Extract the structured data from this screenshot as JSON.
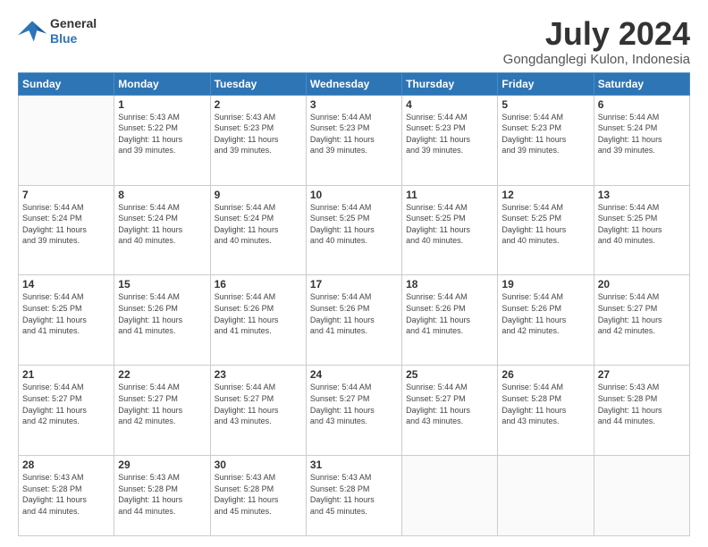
{
  "header": {
    "logo_line1": "General",
    "logo_line2": "Blue",
    "title": "July 2024",
    "subtitle": "Gongdanglegi Kulon, Indonesia"
  },
  "calendar": {
    "days_of_week": [
      "Sunday",
      "Monday",
      "Tuesday",
      "Wednesday",
      "Thursday",
      "Friday",
      "Saturday"
    ],
    "weeks": [
      [
        {
          "day": "",
          "info": ""
        },
        {
          "day": "1",
          "info": "Sunrise: 5:43 AM\nSunset: 5:22 PM\nDaylight: 11 hours\nand 39 minutes."
        },
        {
          "day": "2",
          "info": "Sunrise: 5:43 AM\nSunset: 5:23 PM\nDaylight: 11 hours\nand 39 minutes."
        },
        {
          "day": "3",
          "info": "Sunrise: 5:44 AM\nSunset: 5:23 PM\nDaylight: 11 hours\nand 39 minutes."
        },
        {
          "day": "4",
          "info": "Sunrise: 5:44 AM\nSunset: 5:23 PM\nDaylight: 11 hours\nand 39 minutes."
        },
        {
          "day": "5",
          "info": "Sunrise: 5:44 AM\nSunset: 5:23 PM\nDaylight: 11 hours\nand 39 minutes."
        },
        {
          "day": "6",
          "info": "Sunrise: 5:44 AM\nSunset: 5:24 PM\nDaylight: 11 hours\nand 39 minutes."
        }
      ],
      [
        {
          "day": "7",
          "info": "Sunrise: 5:44 AM\nSunset: 5:24 PM\nDaylight: 11 hours\nand 39 minutes."
        },
        {
          "day": "8",
          "info": "Sunrise: 5:44 AM\nSunset: 5:24 PM\nDaylight: 11 hours\nand 40 minutes."
        },
        {
          "day": "9",
          "info": "Sunrise: 5:44 AM\nSunset: 5:24 PM\nDaylight: 11 hours\nand 40 minutes."
        },
        {
          "day": "10",
          "info": "Sunrise: 5:44 AM\nSunset: 5:25 PM\nDaylight: 11 hours\nand 40 minutes."
        },
        {
          "day": "11",
          "info": "Sunrise: 5:44 AM\nSunset: 5:25 PM\nDaylight: 11 hours\nand 40 minutes."
        },
        {
          "day": "12",
          "info": "Sunrise: 5:44 AM\nSunset: 5:25 PM\nDaylight: 11 hours\nand 40 minutes."
        },
        {
          "day": "13",
          "info": "Sunrise: 5:44 AM\nSunset: 5:25 PM\nDaylight: 11 hours\nand 40 minutes."
        }
      ],
      [
        {
          "day": "14",
          "info": "Sunrise: 5:44 AM\nSunset: 5:25 PM\nDaylight: 11 hours\nand 41 minutes."
        },
        {
          "day": "15",
          "info": "Sunrise: 5:44 AM\nSunset: 5:26 PM\nDaylight: 11 hours\nand 41 minutes."
        },
        {
          "day": "16",
          "info": "Sunrise: 5:44 AM\nSunset: 5:26 PM\nDaylight: 11 hours\nand 41 minutes."
        },
        {
          "day": "17",
          "info": "Sunrise: 5:44 AM\nSunset: 5:26 PM\nDaylight: 11 hours\nand 41 minutes."
        },
        {
          "day": "18",
          "info": "Sunrise: 5:44 AM\nSunset: 5:26 PM\nDaylight: 11 hours\nand 41 minutes."
        },
        {
          "day": "19",
          "info": "Sunrise: 5:44 AM\nSunset: 5:26 PM\nDaylight: 11 hours\nand 42 minutes."
        },
        {
          "day": "20",
          "info": "Sunrise: 5:44 AM\nSunset: 5:27 PM\nDaylight: 11 hours\nand 42 minutes."
        }
      ],
      [
        {
          "day": "21",
          "info": "Sunrise: 5:44 AM\nSunset: 5:27 PM\nDaylight: 11 hours\nand 42 minutes."
        },
        {
          "day": "22",
          "info": "Sunrise: 5:44 AM\nSunset: 5:27 PM\nDaylight: 11 hours\nand 42 minutes."
        },
        {
          "day": "23",
          "info": "Sunrise: 5:44 AM\nSunset: 5:27 PM\nDaylight: 11 hours\nand 43 minutes."
        },
        {
          "day": "24",
          "info": "Sunrise: 5:44 AM\nSunset: 5:27 PM\nDaylight: 11 hours\nand 43 minutes."
        },
        {
          "day": "25",
          "info": "Sunrise: 5:44 AM\nSunset: 5:27 PM\nDaylight: 11 hours\nand 43 minutes."
        },
        {
          "day": "26",
          "info": "Sunrise: 5:44 AM\nSunset: 5:28 PM\nDaylight: 11 hours\nand 43 minutes."
        },
        {
          "day": "27",
          "info": "Sunrise: 5:43 AM\nSunset: 5:28 PM\nDaylight: 11 hours\nand 44 minutes."
        }
      ],
      [
        {
          "day": "28",
          "info": "Sunrise: 5:43 AM\nSunset: 5:28 PM\nDaylight: 11 hours\nand 44 minutes."
        },
        {
          "day": "29",
          "info": "Sunrise: 5:43 AM\nSunset: 5:28 PM\nDaylight: 11 hours\nand 44 minutes."
        },
        {
          "day": "30",
          "info": "Sunrise: 5:43 AM\nSunset: 5:28 PM\nDaylight: 11 hours\nand 45 minutes."
        },
        {
          "day": "31",
          "info": "Sunrise: 5:43 AM\nSunset: 5:28 PM\nDaylight: 11 hours\nand 45 minutes."
        },
        {
          "day": "",
          "info": ""
        },
        {
          "day": "",
          "info": ""
        },
        {
          "day": "",
          "info": ""
        }
      ]
    ]
  }
}
